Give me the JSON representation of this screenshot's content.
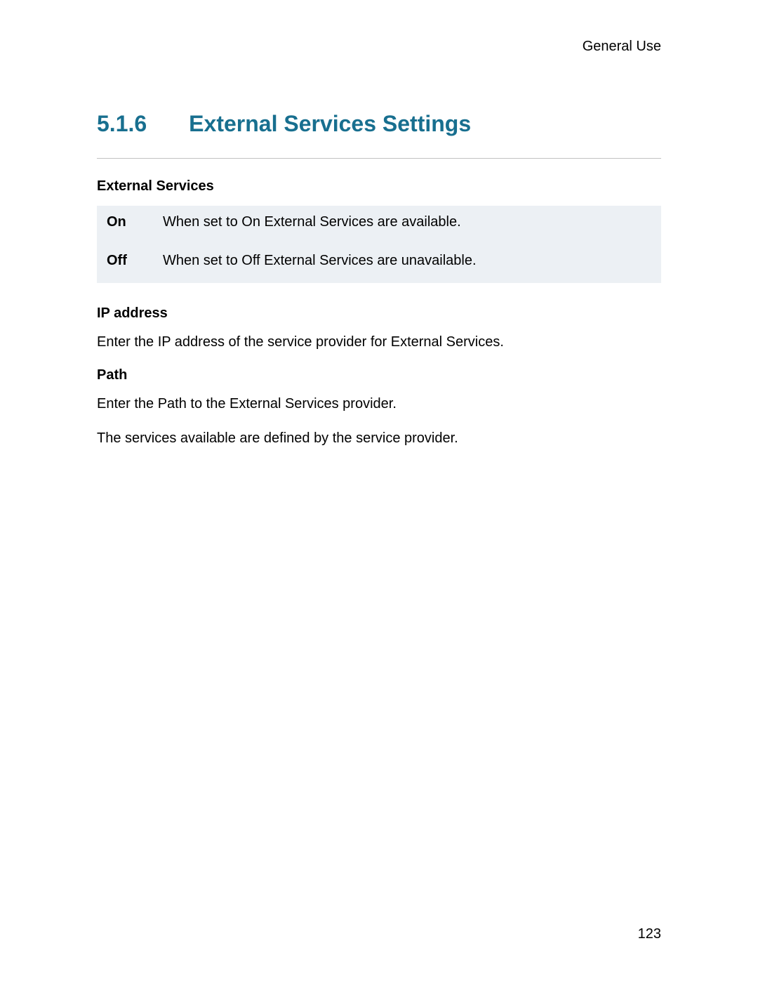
{
  "header": {
    "running_title": "General Use"
  },
  "section": {
    "number": "5.1.6",
    "title": "External Services Settings"
  },
  "external_services": {
    "heading": "External Services",
    "rows": [
      {
        "key": "On",
        "desc": "When set to On External Services are available."
      },
      {
        "key": "Off",
        "desc": "When set to Off External Services are unavailable."
      }
    ]
  },
  "ip_address": {
    "heading": "IP address",
    "text": "Enter the IP address of the service provider for External Services."
  },
  "path": {
    "heading": "Path",
    "text1": "Enter the Path to the External Services provider.",
    "text2": "The services available are defined by the service provider."
  },
  "footer": {
    "page_number": "123"
  }
}
